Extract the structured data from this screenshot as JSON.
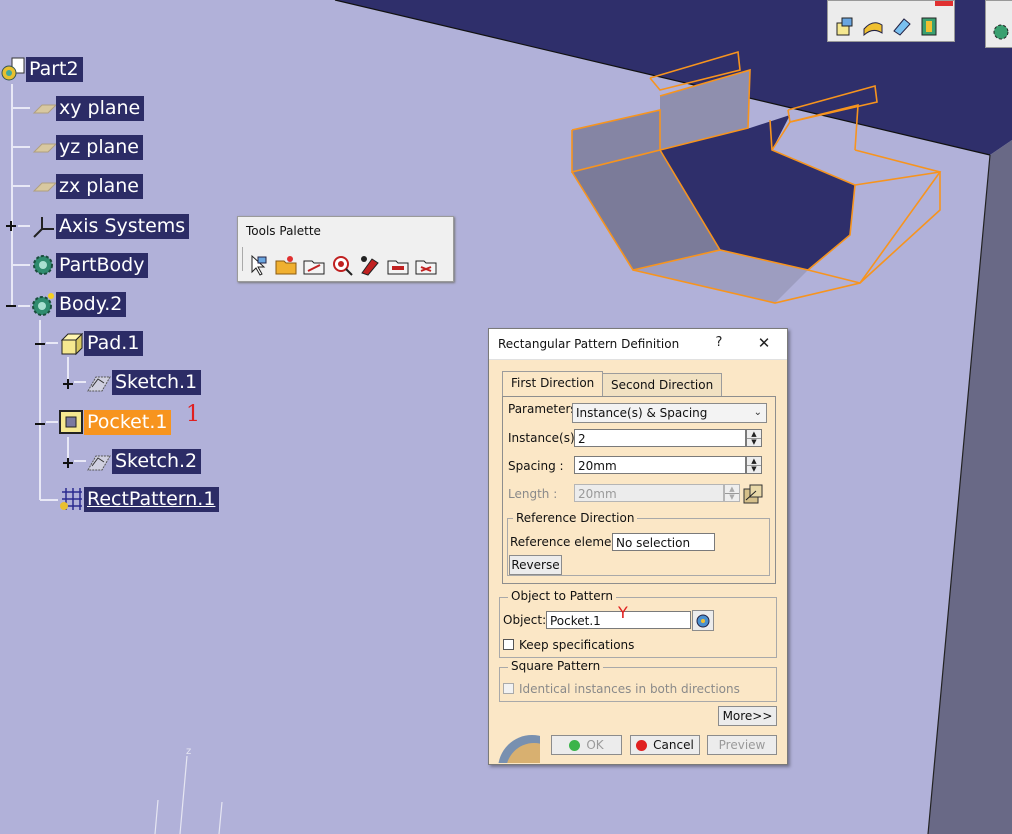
{
  "tree": {
    "root": "Part2",
    "nodes": [
      {
        "label": "xy plane"
      },
      {
        "label": "yz plane"
      },
      {
        "label": "zx plane"
      },
      {
        "label": "Axis Systems"
      },
      {
        "label": "PartBody"
      },
      {
        "label": "Body.2"
      },
      {
        "label": "Pad.1"
      },
      {
        "label": "Sketch.1"
      },
      {
        "label": "Pocket.1"
      },
      {
        "label": "Sketch.2"
      },
      {
        "label": "RectPattern.1"
      }
    ],
    "annotation": "1"
  },
  "tools_palette": {
    "title": "Tools Palette",
    "icons": [
      "select-icon",
      "open-folder-icon",
      "measure-icon",
      "zoom-target-icon",
      "sketch-tool-icon",
      "folder-measure-icon",
      "folder-constraint-icon"
    ]
  },
  "top_toolbar": {
    "icons": [
      "product-icon",
      "surface-icon",
      "eraser-icon",
      "shape-icon"
    ]
  },
  "dialog": {
    "title": "Rectangular Pattern Definition",
    "help": "?",
    "close": "✕",
    "tabs": [
      "First Direction",
      "Second Direction"
    ],
    "active_tab": "First Direction",
    "parameters_label": "Parameters:",
    "parameters_value": "Instance(s) & Spacing",
    "instances_label": "Instance(s) :",
    "instances_value": "2",
    "spacing_label": "Spacing :",
    "spacing_value": "20mm",
    "length_label": "Length :",
    "length_value": "20mm",
    "reference_direction_title": "Reference Direction",
    "reference_element_label": "Reference element:",
    "reference_element_value": "No selection",
    "reverse_label": "Reverse",
    "object_to_pattern_title": "Object to Pattern",
    "object_label": "Object:",
    "object_value": "Pocket.1",
    "object_annotation": "Y",
    "keep_specifications_label": "Keep specifications",
    "square_pattern_title": "Square Pattern",
    "identical_instances_label": "Identical instances in both directions",
    "more_label": "More>>",
    "ok_label": "OK",
    "cancel_label": "Cancel",
    "preview_label": "Preview"
  },
  "colors": {
    "background": "#b1b1d9",
    "dark_face": "#2f2f6b",
    "edge_highlight": "#f7941e",
    "tree_label_bg": "#2c2c66",
    "dialog_bg": "#fbe7c6"
  }
}
